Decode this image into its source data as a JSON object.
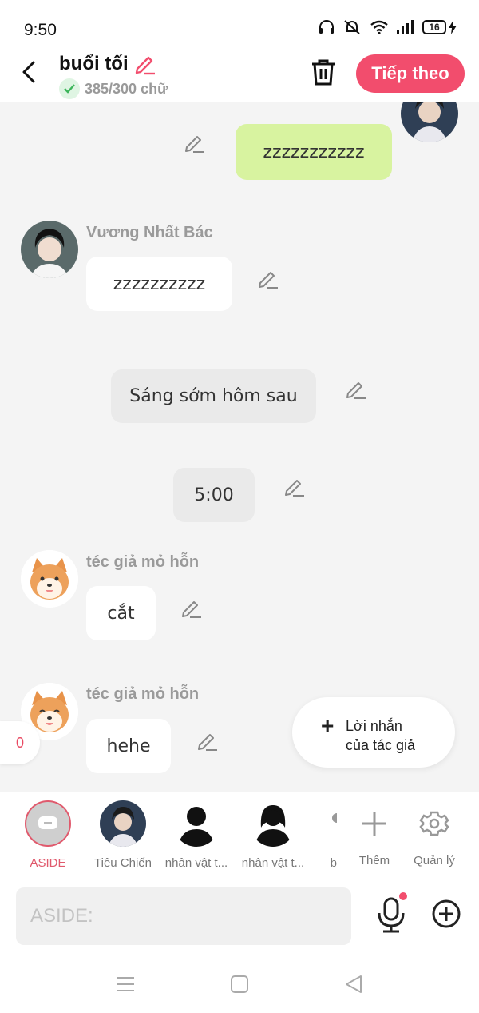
{
  "status_bar": {
    "time": "9:50",
    "battery": "16"
  },
  "header": {
    "title": "buổi tối",
    "word_count": "385/300 chữ",
    "next_label": "Tiếp theo"
  },
  "messages": {
    "m1": {
      "text": "zzzzzzzzzzz"
    },
    "m2": {
      "name": "Vương Nhất Bác",
      "text": "zzzzzzzzzz"
    },
    "m3": {
      "text": "Sáng sớm hôm sau"
    },
    "m4": {
      "text": "5:00"
    },
    "m5": {
      "name": "téc giả mỏ hỗn",
      "text": "cắt"
    },
    "m6": {
      "name": "téc giả mỏ hỗn",
      "text": "hehe"
    }
  },
  "count_tab": "0",
  "author_note": {
    "line1": "Lời nhắn",
    "line2": "của tác giả"
  },
  "characters": [
    {
      "label": "ASIDE"
    },
    {
      "label": "Tiêu Chiến"
    },
    {
      "label": "nhân vật t..."
    },
    {
      "label": "nhân vật t..."
    },
    {
      "label": "b"
    }
  ],
  "actions": {
    "add_label": "Thêm",
    "manage_label": "Quản lý"
  },
  "input": {
    "placeholder": "ASIDE:"
  },
  "colors": {
    "accent": "#f24d6d",
    "green_bubble": "#d8f3a0",
    "background": "#f4f4f4"
  }
}
